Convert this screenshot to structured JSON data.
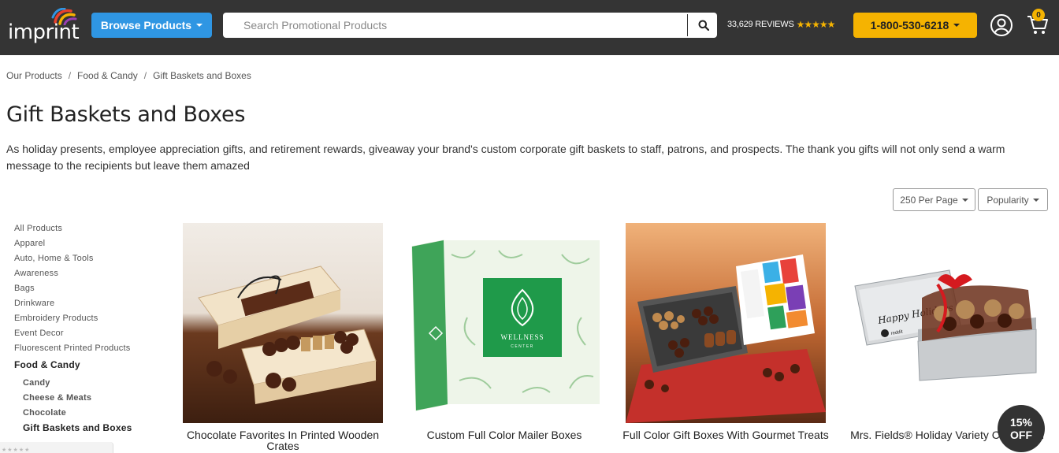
{
  "header": {
    "logo_text": "imprint",
    "browse_label": "Browse Products",
    "search_placeholder": "Search Promotional Products",
    "reviews_count": "33,629 REVIEWS",
    "reviews_stars": "★★★★★",
    "phone_label": "1-800-530-6218",
    "cart_count": "0",
    "colors": {
      "bar": "#343434",
      "browse": "#2f96e3",
      "phone": "#f5b301"
    }
  },
  "breadcrumb": [
    {
      "label": "Our Products"
    },
    {
      "label": "Food & Candy"
    },
    {
      "label": "Gift Baskets and Boxes"
    }
  ],
  "page": {
    "title": "Gift Baskets and Boxes",
    "description": "As holiday presents, employee appreciation gifts, and retirement rewards, giveaway your brand's custom corporate gift baskets to staff, patrons, and prospects. The thank you gifts will not only send a warm message to the recipients but leave them amazed"
  },
  "controls": {
    "per_page_label": "250 Per Page",
    "sort_label": "Popularity"
  },
  "sidebar": {
    "items": [
      {
        "label": "All Products"
      },
      {
        "label": "Apparel"
      },
      {
        "label": "Auto, Home & Tools"
      },
      {
        "label": "Awareness"
      },
      {
        "label": "Bags"
      },
      {
        "label": "Drinkware"
      },
      {
        "label": "Embroidery Products"
      },
      {
        "label": "Event Decor"
      },
      {
        "label": "Fluorescent Printed Products"
      }
    ],
    "active_parent": "Food & Candy",
    "sub_items": [
      {
        "label": "Candy"
      },
      {
        "label": "Cheese & Meats"
      },
      {
        "label": "Chocolate"
      },
      {
        "label": "Gift Baskets and Boxes"
      }
    ]
  },
  "products": [
    {
      "name": "Chocolate Favorites In Printed Wooden Crates",
      "icon": "chocolate-crate-image"
    },
    {
      "name": "Custom Full Color Mailer Boxes",
      "icon": "mailer-box-image",
      "box_text": "WELLNESS",
      "box_subtext": "CENTER"
    },
    {
      "name": "Full Color Gift Boxes With Gourmet Treats",
      "icon": "gourmet-gift-box-image"
    },
    {
      "name": "Mrs. Fields® Holiday Variety Cookie Tin",
      "icon": "cookie-tin-image",
      "tin_text": "Happy Holidays",
      "tin_brand": "reddit"
    }
  ],
  "promo": {
    "line1": "15%",
    "line2": "OFF"
  }
}
